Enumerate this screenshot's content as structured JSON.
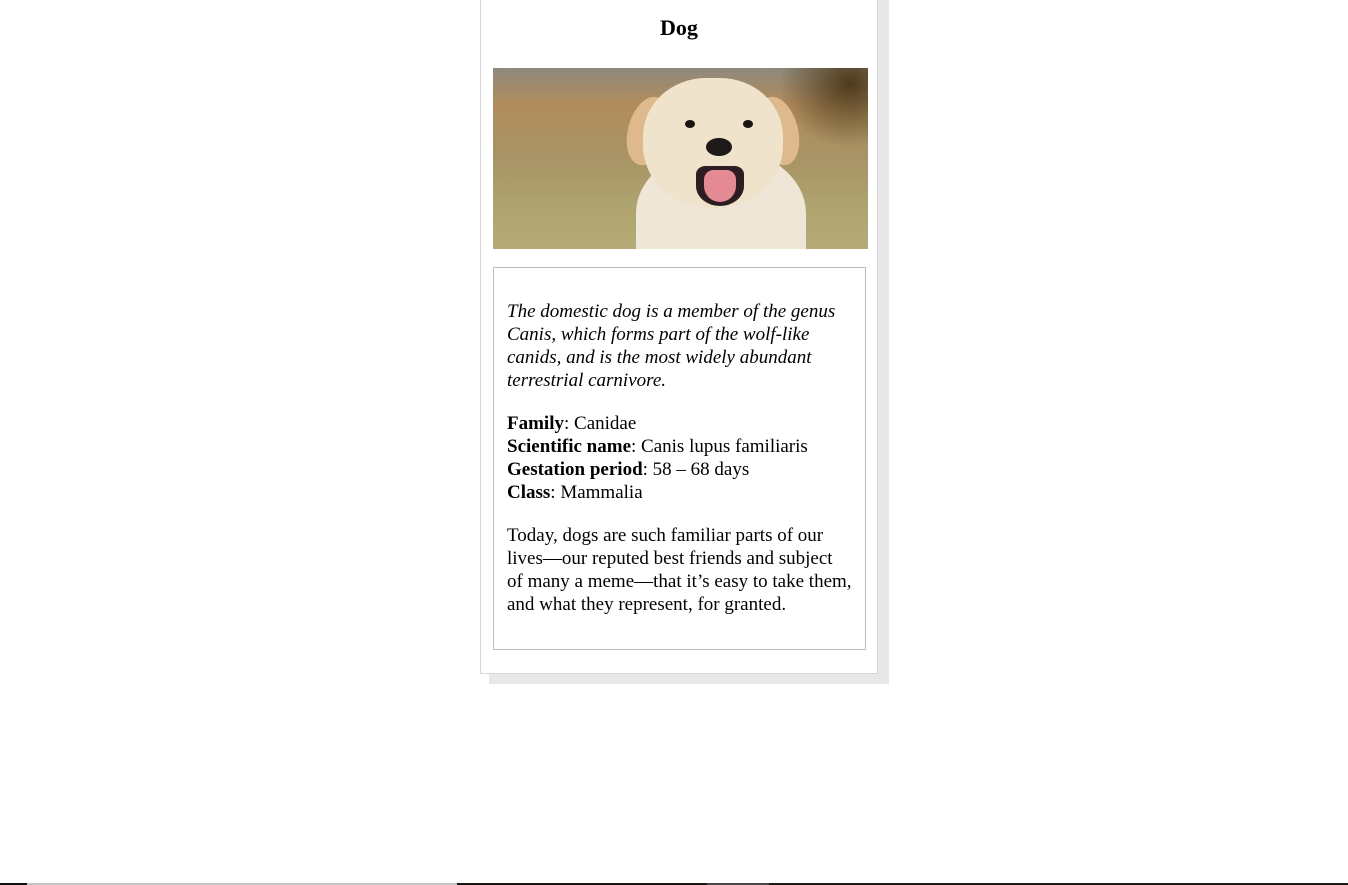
{
  "card": {
    "title": "Dog",
    "image_alt": "Golden retriever puppy",
    "intro": "The domestic dog is a member of the genus Canis, which forms part of the wolf-like canids, and is the most widely abundant terrestrial carnivore.",
    "facts": [
      {
        "label": "Family",
        "value": ": Canidae"
      },
      {
        "label": "Scientific name",
        "value": ": Canis lupus familiaris"
      },
      {
        "label": "Gestation period",
        "value": ": 58 – 68 days"
      },
      {
        "label": "Class",
        "value": ": Mammalia"
      }
    ],
    "outro": "Today, dogs are such familiar parts of our lives—our reputed best friends and subject of many a meme—that it’s easy to take them, and what they represent, for granted."
  }
}
